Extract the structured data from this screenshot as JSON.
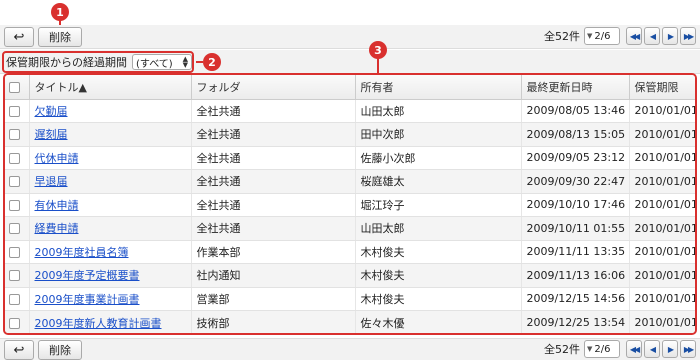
{
  "toolbar": {
    "back_icon": "back-arrow-icon",
    "delete_label": "削除",
    "total_count": "全52件",
    "page_select": "2/6",
    "nav_first": "◀◀",
    "nav_prev": "◀",
    "nav_next": "▶",
    "nav_last": "▶▶"
  },
  "filter": {
    "label": "保管期限からの経過期間",
    "selected": "(すべて)"
  },
  "table": {
    "headers": {
      "title": "タイトル▲",
      "folder": "フォルダ",
      "owner": "所有者",
      "updated": "最終更新日時",
      "retention": "保管期限"
    },
    "rows": [
      {
        "title": "欠勤届",
        "folder": "全社共通",
        "owner": "山田太郎",
        "updated": "2009/08/05 13:46",
        "retention": "2010/01/01"
      },
      {
        "title": "遅刻届",
        "folder": "全社共通",
        "owner": "田中次郎",
        "updated": "2009/08/13 15:05",
        "retention": "2010/01/01"
      },
      {
        "title": "代休申請",
        "folder": "全社共通",
        "owner": "佐藤小次郎",
        "updated": "2009/09/05 23:12",
        "retention": "2010/01/01"
      },
      {
        "title": "早退届",
        "folder": "全社共通",
        "owner": "桜庭雄太",
        "updated": "2009/09/30 22:47",
        "retention": "2010/01/01"
      },
      {
        "title": "有休申請",
        "folder": "全社共通",
        "owner": "堀江玲子",
        "updated": "2009/10/10 17:46",
        "retention": "2010/01/01"
      },
      {
        "title": "経費申請",
        "folder": "全社共通",
        "owner": "山田太郎",
        "updated": "2009/10/11 01:55",
        "retention": "2010/01/01"
      },
      {
        "title": "2009年度社員名簿",
        "folder": "作業本部",
        "owner": "木村俊夫",
        "updated": "2009/11/11 13:35",
        "retention": "2010/01/01"
      },
      {
        "title": "2009年度予定概要書",
        "folder": "社内通知",
        "owner": "木村俊夫",
        "updated": "2009/11/13 16:06",
        "retention": "2010/01/01"
      },
      {
        "title": "2009年度事業計画書",
        "folder": "営業部",
        "owner": "木村俊夫",
        "updated": "2009/12/15 14:56",
        "retention": "2010/01/01"
      },
      {
        "title": "2009年度新人教育計画書",
        "folder": "技術部",
        "owner": "佐々木優",
        "updated": "2009/12/25 13:54",
        "retention": "2010/01/01"
      }
    ]
  },
  "callouts": [
    "1",
    "2",
    "3"
  ],
  "colors": {
    "accent": "#d9302e",
    "link": "#1a4fc9"
  }
}
